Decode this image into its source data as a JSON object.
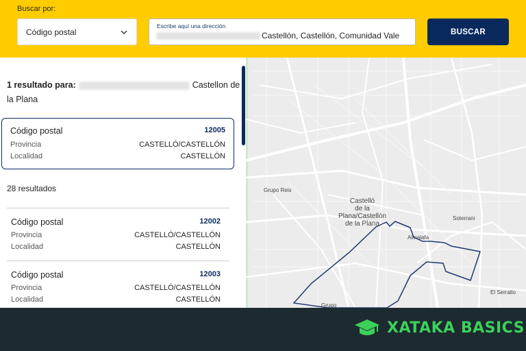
{
  "header": {
    "search_label": "Buscar por:",
    "select_value": "Código postal",
    "address_label": "Escribe aquí una dirección",
    "address_value": "Castellón, Castellón, Comunidad Vale",
    "search_button": "BUSCAR"
  },
  "results": {
    "summary_prefix": "1 resultado para:",
    "summary_suffix": "Castellon de la Plana",
    "selected": {
      "title": "Código postal",
      "postal_code": "12005",
      "provincia_label": "Provincia",
      "provincia_value": "CASTELLÓ/CASTELLÓN",
      "localidad_label": "Localidad",
      "localidad_value": "CASTELLÓN"
    },
    "count_label": "28 resultados",
    "items": [
      {
        "title": "Código postal",
        "postal_code": "12002",
        "provincia_label": "Provincia",
        "provincia_value": "CASTELLÓ/CASTELLÓN",
        "localidad_label": "Localidad",
        "localidad_value": "CASTELLÓN"
      },
      {
        "title": "Código postal",
        "postal_code": "12003",
        "provincia_label": "Provincia",
        "provincia_value": "CASTELLÓ/CASTELLÓN",
        "localidad_label": "Localidad",
        "localidad_value": "CASTELLÓN"
      }
    ]
  },
  "map": {
    "labels": {
      "city_1": "Castelló",
      "city_2": "de la",
      "city_3": "Plana/Castellón",
      "city_4": "de la Plana",
      "grupo_reis": "Grupo Reis",
      "soterrani": "Soterrani",
      "almalafa": "Almalafa",
      "el_serrallo": "El Serrallo",
      "grupo": "Grupo"
    },
    "polygon_color": "#1e3a6e"
  },
  "footer": {
    "brand": "XATAKA BASICS",
    "brand_color": "#3bd15a"
  },
  "colors": {
    "accent_yellow": "#ffcc00",
    "navy": "#0a2a5e"
  }
}
